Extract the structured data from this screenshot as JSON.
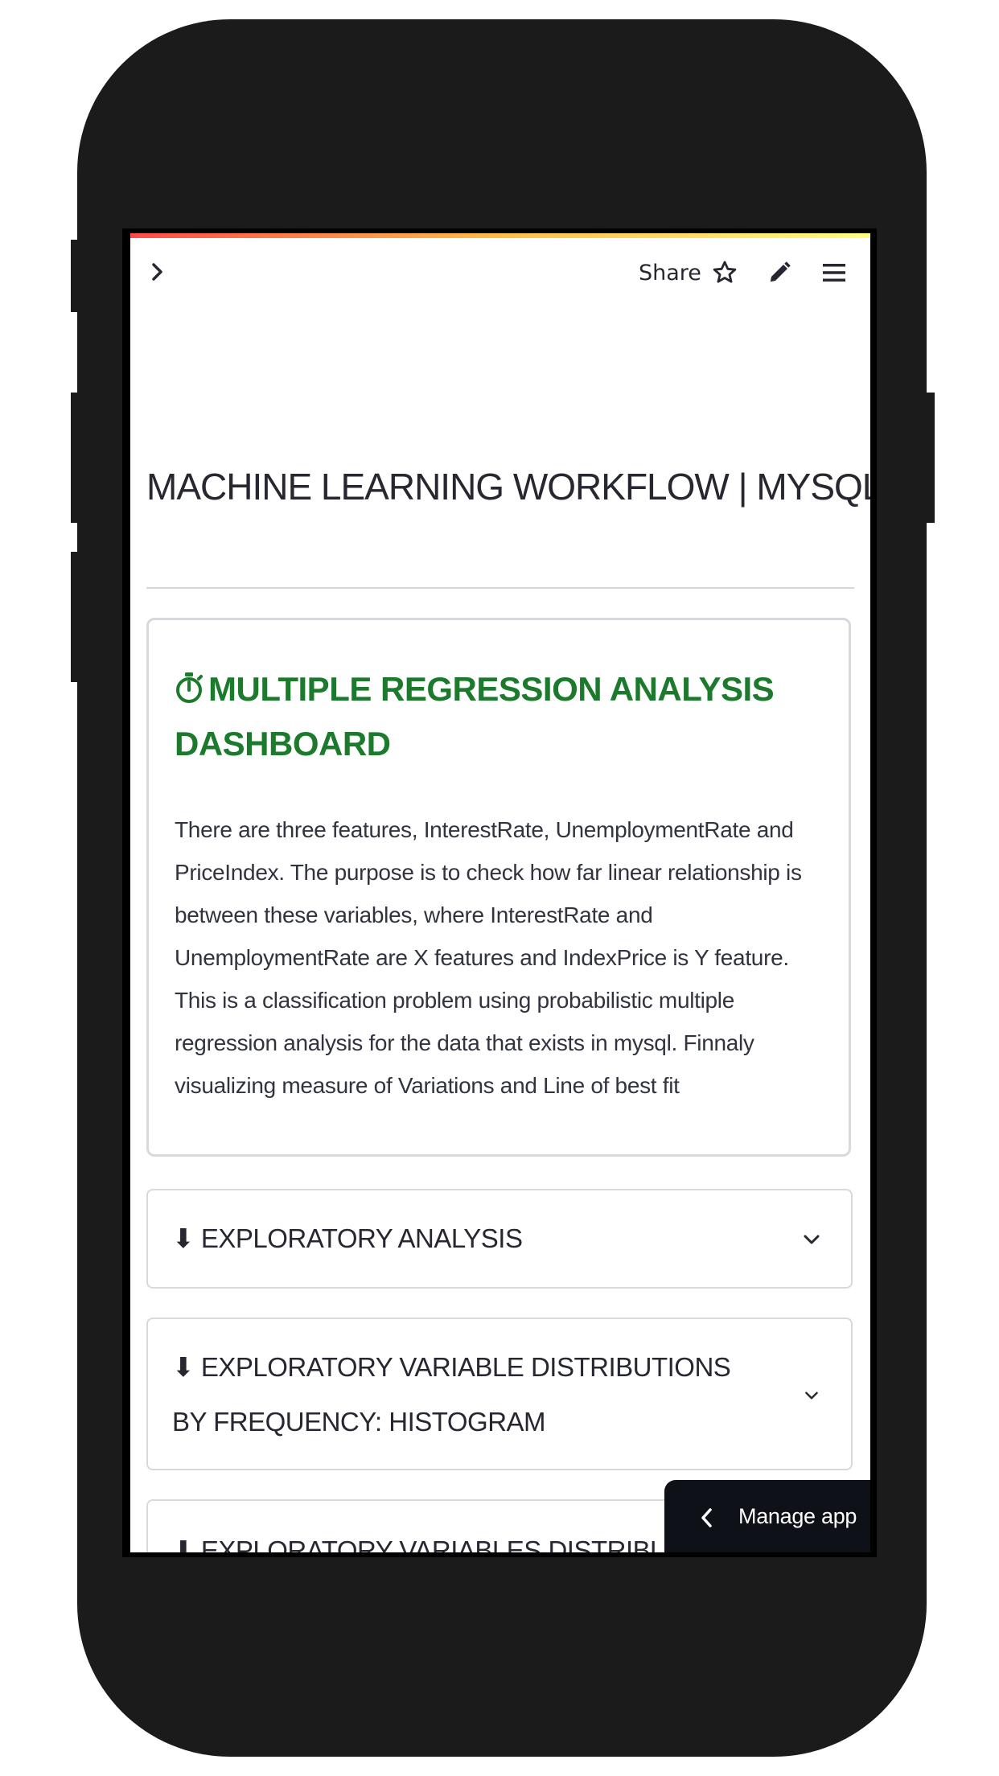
{
  "header": {
    "share_label": "Share"
  },
  "page": {
    "title": "MACHINE LEARNING WORKFLOW | MYSQL"
  },
  "card": {
    "title": "MULTIPLE REGRESSION ANALYSIS DASHBOARD",
    "title_icon": "stopwatch-icon",
    "title_color": "#1b7a2c",
    "body": "There are three features, InterestRate, UnemploymentRate and PriceIndex. The purpose is to check how far linear relationship is between these variables, where InterestRate and UnemploymentRate are X features and IndexPrice is Y feature. This is a classification problem using probabilistic multiple regression analysis for the data that exists in mysql. Finnaly visualizing measure of Variations and Line of best fit"
  },
  "expanders": [
    {
      "label": "⬇ EXPLORATORY ANALYSIS"
    },
    {
      "label": "⬇ EXPLORATORY VARIABLE DISTRIBUTIONS BY FREQUENCY: HISTOGRAM"
    },
    {
      "label": "⬇ EXPLORATORY VARIABLES DISTRIBUTIONS"
    }
  ],
  "manage_app": {
    "label": "Manage app"
  },
  "colors": {
    "accent_gradient_start": "#ff4b4b",
    "accent_gradient_end": "#fffd80",
    "manage_bg": "#0e1117"
  }
}
